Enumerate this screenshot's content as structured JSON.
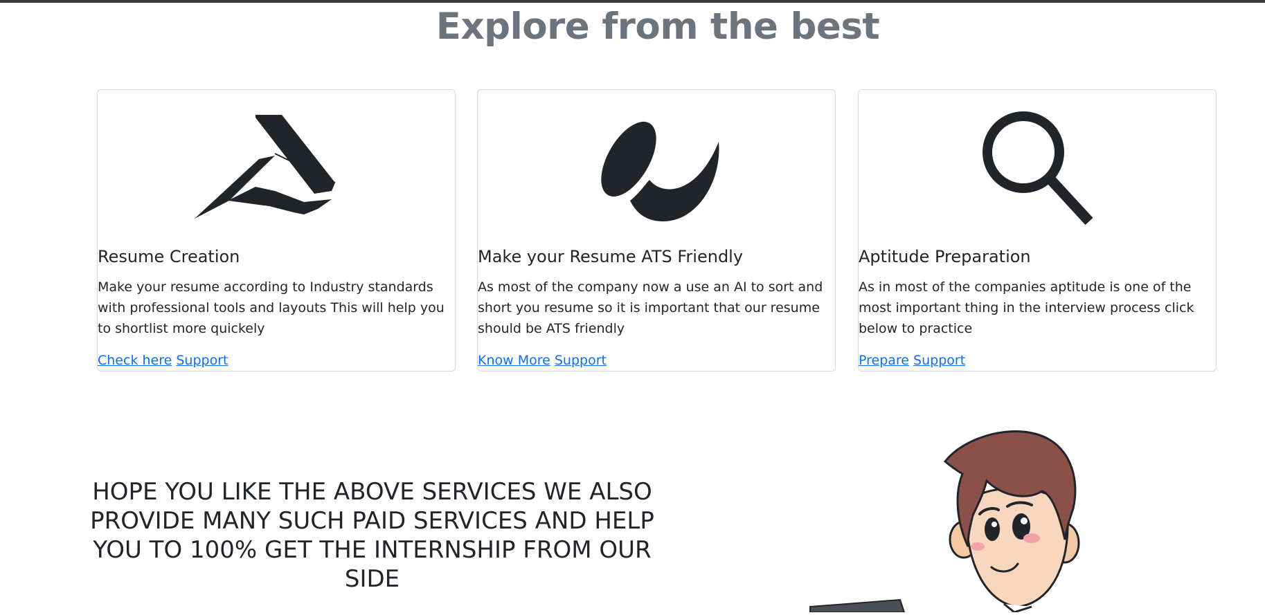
{
  "page": {
    "title": "Explore from the best"
  },
  "cards": [
    {
      "title": "Resume Creation",
      "text": "Make your resume according to Industry standards with professional tools and layouts This will help you to shortlist more quickely",
      "primary_link": "Check here",
      "secondary_link": "Support",
      "icon": "document-pen-icon"
    },
    {
      "title": "Make your Resume ATS Friendly",
      "text": "As most of the company now a use an AI to sort and short you resume so it is important that our resume should be ATS friendly",
      "primary_link": "Know More",
      "secondary_link": "Support",
      "icon": "ai-brand-icon"
    },
    {
      "title": "Aptitude Preparation",
      "text": "As in most of the companies aptitude is one of the most important thing in the interview process click below to practice",
      "primary_link": "Prepare",
      "secondary_link": "Support",
      "icon": "search-icon"
    }
  ],
  "promo": {
    "text": "HOPE YOU LIKE THE ABOVE SERVICES WE ALSO PROVIDE MANY SUCH PAID SERVICES AND HELP YOU TO 100% GET THE INTERNSHIP FROM OUR SIDE"
  },
  "colors": {
    "title": "#6c757d",
    "text": "#212529",
    "link": "#0d6efd",
    "icon": "#212529",
    "border": "#d7d9dc"
  }
}
